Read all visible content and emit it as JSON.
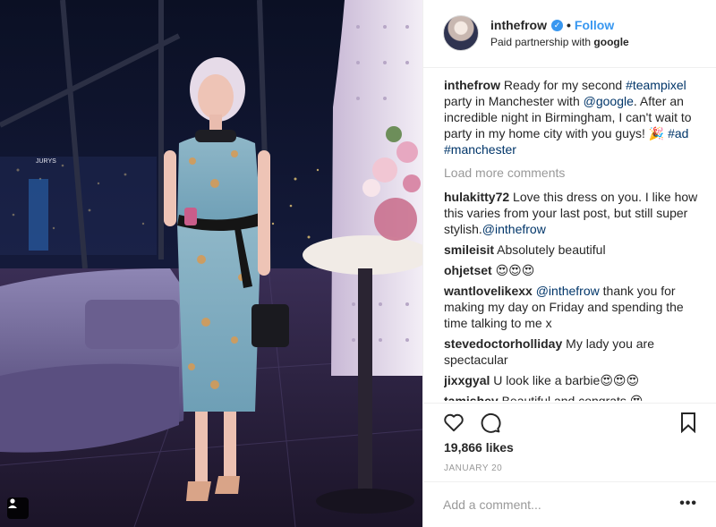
{
  "post": {
    "username": "inthefrow",
    "follow_label": "Follow",
    "separator": "•",
    "subtitle_prefix": "Paid partnership with ",
    "subtitle_partner": "google"
  },
  "caption": {
    "user": "inthefrow",
    "t1": " Ready for my second ",
    "tag1": "#teampixel",
    "t2": " party in Manchester with ",
    "tag2": "@google",
    "t3": ". After an incredible night in Birmingham, I can't wait to party in my home city with you guys! 🎉 ",
    "tag3": "#ad",
    "t4": " ",
    "tag4": "#manchester"
  },
  "load_more": "Load more comments",
  "comments": [
    {
      "user": "hulakitty72",
      "text": " Love this dress on you. I like how this varies from your last post, but still super stylish.",
      "mention": "@inthefrow",
      "after": ""
    },
    {
      "user": "smileisit",
      "text": " Absolutely beautiful",
      "mention": "",
      "after": ""
    },
    {
      "user": "ohjetset",
      "text": " 😍😍😍",
      "mention": "",
      "after": ""
    },
    {
      "user": "wantlovelikexx",
      "text": " ",
      "mention": "@inthefrow",
      "after": " thank you for making my day on Friday and spending the time talking to me x"
    },
    {
      "user": "stevedoctorholliday",
      "text": " My lady you are spectacular",
      "mention": "",
      "after": ""
    },
    {
      "user": "jixxgyal",
      "text": " U look like a barbie😍😍😍",
      "mention": "",
      "after": ""
    },
    {
      "user": "tamishey",
      "text": " Beautiful and congrats 😍",
      "mention": "",
      "after": ""
    }
  ],
  "likes": "19,866 likes",
  "date": "JANUARY 20",
  "add_comment_placeholder": "Add a comment...",
  "more_label": "•••",
  "photo_sign": "JURYS",
  "icons": {
    "verified": "verified-badge-icon",
    "like": "heart-icon",
    "comment": "speech-bubble-icon",
    "save": "bookmark-icon",
    "tag": "user-tag-icon"
  },
  "colors": {
    "link": "#003569",
    "follow": "#3897f0",
    "muted": "#999999",
    "text": "#262626"
  }
}
